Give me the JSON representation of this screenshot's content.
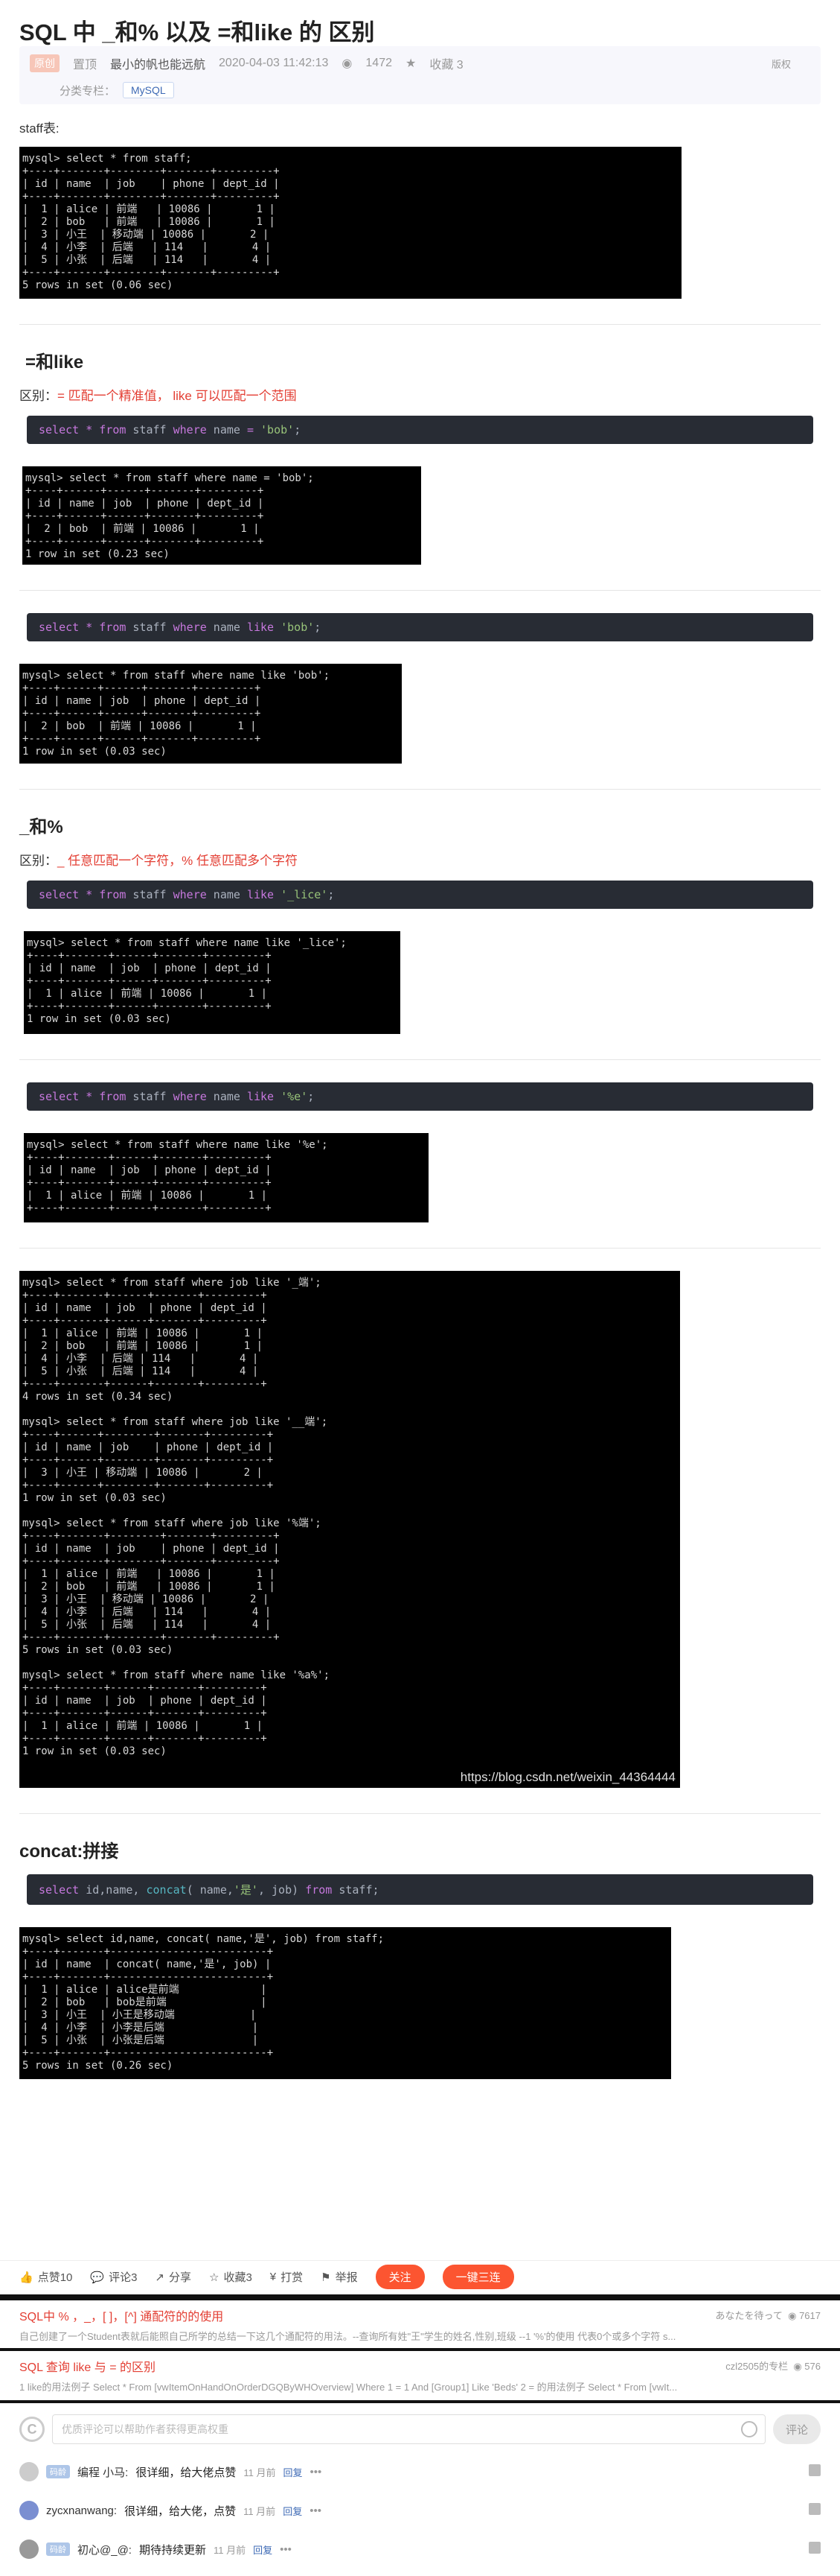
{
  "article": {
    "title": "SQL 中 _和% 以及 =和like 的 区别",
    "tag": "原创",
    "top_label": "置顶",
    "author": "最小的帆也能远航",
    "date": "2020-04-03 11:42:13",
    "views": "1472",
    "favorites": "收藏 3",
    "copyright": "版权",
    "category_label": "分类专栏：",
    "category": "MySQL"
  },
  "sections": {
    "staff_label": "staff表:",
    "h_eq_like": "=和like",
    "diff_label": "区别：",
    "diff_eq_like": "= 匹配一个精准值， like 可以匹配一个范围",
    "h_underscore_percent": "_和%",
    "diff_up": "_ 任意匹配一个字符，% 任意匹配多个字符",
    "h_concat": "concat:拼接"
  },
  "code": {
    "c1": "select * from staff where name = 'bob';",
    "c2": "select * from staff where name like 'bob';",
    "c3": "select * from staff where name like '_lice';",
    "c4": "select * from staff where name like '%e';",
    "c5": "select id,name, concat( name,'是', job) from staff;"
  },
  "terms": {
    "t1": "mysql> select * from staff;\n+----+-------+--------+-------+---------+\n| id | name  | job    | phone | dept_id |\n+----+-------+--------+-------+---------+\n|  1 | alice | 前端   | 10086 |       1 |\n|  2 | bob   | 前端   | 10086 |       1 |\n|  3 | 小王  | 移动端 | 10086 |       2 |\n|  4 | 小李  | 后端   | 114   |       4 |\n|  5 | 小张  | 后端   | 114   |       4 |\n+----+-------+--------+-------+---------+\n5 rows in set (0.06 sec)",
    "t2": "mysql> select * from staff where name = 'bob';\n+----+------+------+-------+---------+\n| id | name | job  | phone | dept_id |\n+----+------+------+-------+---------+\n|  2 | bob  | 前端 | 10086 |       1 |\n+----+------+------+-------+---------+\n1 row in set (0.23 sec)",
    "t3": "mysql> select * from staff where name like 'bob';\n+----+------+------+-------+---------+\n| id | name | job  | phone | dept_id |\n+----+------+------+-------+---------+\n|  2 | bob  | 前端 | 10086 |       1 |\n+----+------+------+-------+---------+\n1 row in set (0.03 sec)",
    "t4": "mysql> select * from staff where name like '_lice';\n+----+-------+------+-------+---------+\n| id | name  | job  | phone | dept_id |\n+----+-------+------+-------+---------+\n|  1 | alice | 前端 | 10086 |       1 |\n+----+-------+------+-------+---------+\n1 row in set (0.03 sec)",
    "t5": "mysql> select * from staff where name like '%e';\n+----+-------+------+-------+---------+\n| id | name  | job  | phone | dept_id |\n+----+-------+------+-------+---------+\n|  1 | alice | 前端 | 10086 |       1 |\n+----+-------+------+-------+---------+",
    "t6": "mysql> select * from staff where job like '_端';\n+----+-------+------+-------+---------+\n| id | name  | job  | phone | dept_id |\n+----+-------+------+-------+---------+\n|  1 | alice | 前端 | 10086 |       1 |\n|  2 | bob   | 前端 | 10086 |       1 |\n|  4 | 小李  | 后端 | 114   |       4 |\n|  5 | 小张  | 后端 | 114   |       4 |\n+----+-------+------+-------+---------+\n4 rows in set (0.34 sec)\n\nmysql> select * from staff where job like '__端';\n+----+------+--------+-------+---------+\n| id | name | job    | phone | dept_id |\n+----+------+--------+-------+---------+\n|  3 | 小王 | 移动端 | 10086 |       2 |\n+----+------+--------+-------+---------+\n1 row in set (0.03 sec)\n\nmysql> select * from staff where job like '%端';\n+----+-------+--------+-------+---------+\n| id | name  | job    | phone | dept_id |\n+----+-------+--------+-------+---------+\n|  1 | alice | 前端   | 10086 |       1 |\n|  2 | bob   | 前端   | 10086 |       1 |\n|  3 | 小王  | 移动端 | 10086 |       2 |\n|  4 | 小李  | 后端   | 114   |       4 |\n|  5 | 小张  | 后端   | 114   |       4 |\n+----+-------+--------+-------+---------+\n5 rows in set (0.03 sec)\n\nmysql> select * from staff where name like '%a%';\n+----+-------+------+-------+---------+\n| id | name  | job  | phone | dept_id |\n+----+-------+------+-------+---------+\n|  1 | alice | 前端 | 10086 |       1 |\n+----+-------+------+-------+---------+\n1 row in set (0.03 sec)",
    "t6_watermark": "https://blog.csdn.net/weixin_44364444",
    "t7": "mysql> select id,name, concat( name,'是', job) from staff;\n+----+-------+-------------------------+\n| id | name  | concat( name,'是', job) |\n+----+-------+-------------------------+\n|  1 | alice | alice是前端             |\n|  2 | bob   | bob是前端               |\n|  3 | 小王  | 小王是移动端            |\n|  4 | 小李  | 小李是后端              |\n|  5 | 小张  | 小张是后端              |\n+----+-------+-------------------------+\n5 rows in set (0.26 sec)"
  },
  "actions": {
    "like": "点赞10",
    "comment": "评论3",
    "share": "分享",
    "favorite": "收藏3",
    "reward": "打赏",
    "report": "举报",
    "follow": "关注",
    "triple": "一键三连"
  },
  "recommend": [
    {
      "title": "SQL中 % ，_，[ ]，[^] 通配符的的使用",
      "desc": "自己创建了一个Student表就后能照自己所学的总结一下这几个通配符的用法。--查询所有姓\"王\"学生的姓名,性别,班级 --1 '%'的使用 代表0个或多个字符 s...",
      "author": "あなたを待って",
      "count": "7617"
    },
    {
      "title": "SQL 查询 like 与 = 的区别",
      "desc": "1 like的用法例子 Select * From [vwItemOnHandOnOrderDGQByWHOverview] Where 1 = 1 And [Group1] Like 'Beds' 2 = 的用法例子 Select * From [vwIt...",
      "author": "czl2505的专栏",
      "count": "576"
    }
  ],
  "comment_box": {
    "placeholder": "优质评论可以帮助作者获得更高权重",
    "submit": "评论"
  },
  "comments": [
    {
      "badge": "码龄",
      "name": "编程 小马:",
      "text": "很详细，给大佬点赞",
      "time": "11 月前",
      "reply": "回复"
    },
    {
      "badge": "",
      "name": "zycxnanwang:",
      "text": "很详细，给大佬，点赞",
      "time": "11 月前",
      "reply": "回复"
    },
    {
      "badge": "码龄",
      "name": "初心@_@:",
      "text": "期待持续更新",
      "time": "11 月前",
      "reply": "回复"
    }
  ]
}
